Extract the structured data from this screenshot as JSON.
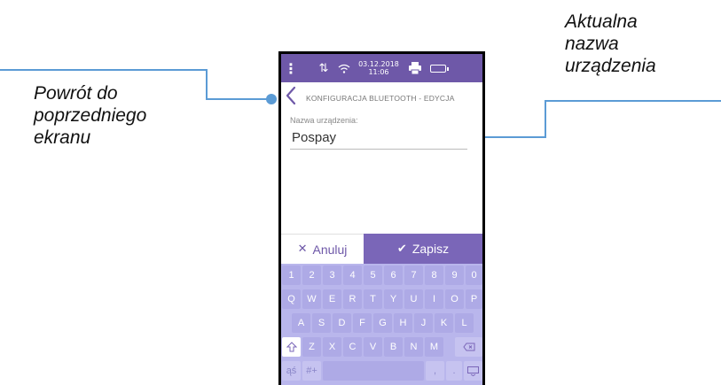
{
  "annotations": {
    "left": [
      "Powrót do",
      "poprzedniego",
      "ekranu"
    ],
    "right": [
      "Aktualna",
      "nazwa",
      "urządzenia"
    ],
    "line_color": "#5b9bd5"
  },
  "statusbar": {
    "menu_icon": "more-vertical-icon",
    "date": "03.12.2018",
    "time": "11:06",
    "color": "#6e58a8"
  },
  "header": {
    "title": "KONFIGURACJA BLUETOOTH - EDYCJA"
  },
  "form": {
    "label": "Nazwa urządzenia:",
    "value": "Pospay"
  },
  "buttons": {
    "cancel": "Anuluj",
    "save": "Zapisz"
  },
  "keyboard": {
    "row1": [
      "1",
      "2",
      "3",
      "4",
      "5",
      "6",
      "7",
      "8",
      "9",
      "0"
    ],
    "row2": [
      "Q",
      "W",
      "E",
      "R",
      "T",
      "Y",
      "U",
      "I",
      "O",
      "P"
    ],
    "row3": [
      "A",
      "S",
      "D",
      "F",
      "G",
      "H",
      "J",
      "K",
      "L"
    ],
    "row4": [
      "Z",
      "X",
      "C",
      "V",
      "B",
      "N",
      "M"
    ],
    "lang_key": "ąś",
    "symbols_key": "#+",
    "comma_key": ",",
    "period_key": "."
  }
}
